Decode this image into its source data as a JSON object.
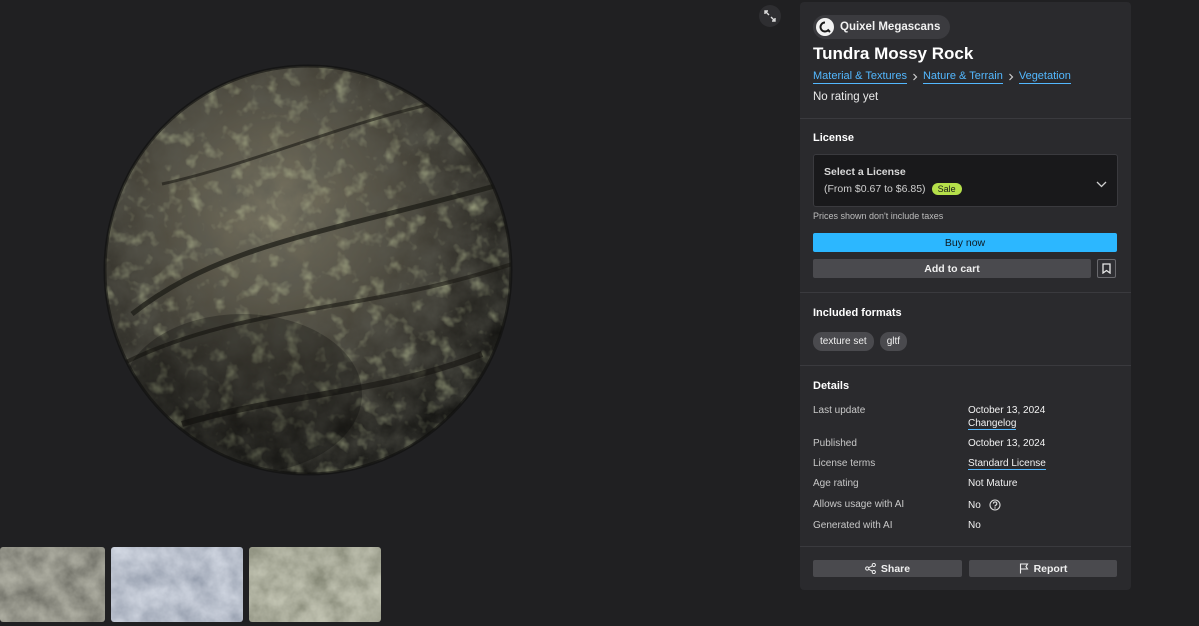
{
  "viewer": {
    "expand_icon": "expand-arrows-icon",
    "thumbnails": [
      "thumbnail-dark-rock",
      "thumbnail-blue-grey-rock",
      "thumbnail-mossy-rock"
    ]
  },
  "asset": {
    "publisher": "Quixel Megascans",
    "title": "Tundra Mossy Rock",
    "breadcrumbs": [
      "Material & Textures",
      "Nature & Terrain",
      "Vegetation"
    ],
    "rating": "No rating yet"
  },
  "license": {
    "heading": "License",
    "select_title": "Select a License",
    "price_range": "(From $0.67 to $6.85)",
    "sale_badge": "Sale",
    "taxes_note": "Prices shown don't include taxes",
    "buy_label": "Buy now",
    "cart_label": "Add to cart"
  },
  "formats": {
    "heading": "Included formats",
    "items": [
      "texture set",
      "gltf"
    ]
  },
  "details": {
    "heading": "Details",
    "last_update_label": "Last update",
    "last_update_value": "October 13, 2024",
    "changelog_label": "Changelog",
    "published_label": "Published",
    "published_value": "October 13, 2024",
    "license_terms_label": "License terms",
    "license_terms_value": "Standard License",
    "age_rating_label": "Age rating",
    "age_rating_value": "Not Mature",
    "ai_usage_label": "Allows usage with AI",
    "ai_usage_value": "No",
    "generated_ai_label": "Generated with AI",
    "generated_ai_value": "No"
  },
  "actions": {
    "share_label": "Share",
    "report_label": "Report"
  },
  "colors": {
    "accent": "#2cb7ff",
    "link": "#53b8ff",
    "sale": "#b5e04a",
    "panel": "#2a2a2d",
    "background": "#202022"
  }
}
